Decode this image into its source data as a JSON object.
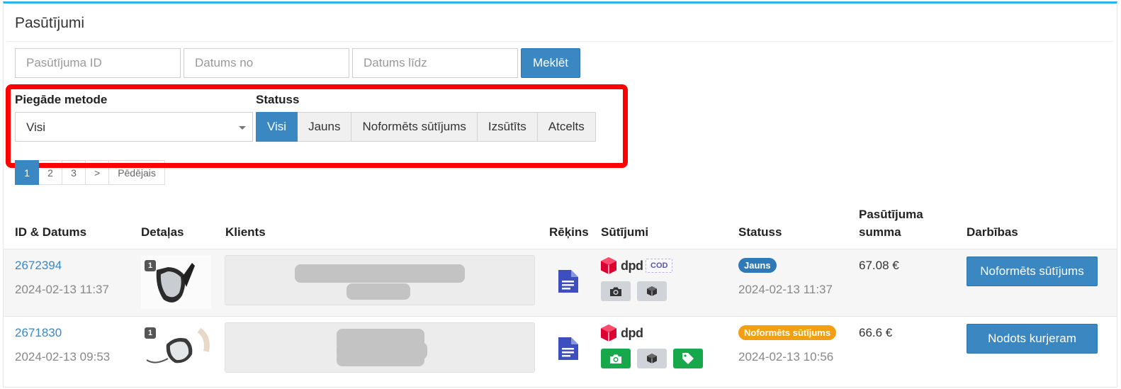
{
  "panel": {
    "title": "Pasūtījumi"
  },
  "search": {
    "order_id_placeholder": "Pasūtījuma ID",
    "date_from_placeholder": "Datums no",
    "date_to_placeholder": "Datums līdz",
    "button_label": "Meklēt"
  },
  "filters": {
    "delivery_label": "Piegāde metode",
    "delivery_value": "Visi",
    "status_label": "Statuss",
    "status_options": [
      "Visi",
      "Jauns",
      "Noformēts sūtījums",
      "Izsūtīts",
      "Atcelts"
    ],
    "status_selected": "Visi"
  },
  "pagination": {
    "pages": [
      "1",
      "2",
      "3"
    ],
    "next": ">",
    "last": "Pēdējais",
    "current": "1"
  },
  "table": {
    "headers": {
      "id_date": "ID & Datums",
      "details": "Detaļas",
      "client": "Klients",
      "invoice": "Rēķins",
      "shipments": "Sūtījumi",
      "status": "Statuss",
      "amount_line1": "Pasūtījuma",
      "amount_line2": "summa",
      "actions": "Darbības"
    },
    "rows": [
      {
        "id": "2672394",
        "date": "2024-02-13 11:37",
        "detail_count": "1",
        "carrier": "dpd",
        "cod": "COD",
        "status": "Jauns",
        "status_date": "2024-02-13 11:37",
        "amount": "67.08 €",
        "action": "Noformēts sūtījums"
      },
      {
        "id": "2671830",
        "date": "2024-02-13 09:53",
        "detail_count": "1",
        "carrier": "dpd",
        "status": "Noformēts sūtījums",
        "status_date": "2024-02-13 10:56",
        "amount": "66.6 €",
        "action": "Nodots kurjeram"
      }
    ]
  },
  "colors": {
    "accent": "#3b87c2",
    "panel_top_border": "#29b6e6",
    "highlight": "#ff0000",
    "status_new": "#2f79b7",
    "status_done": "#f29f13",
    "success": "#17a84b"
  }
}
